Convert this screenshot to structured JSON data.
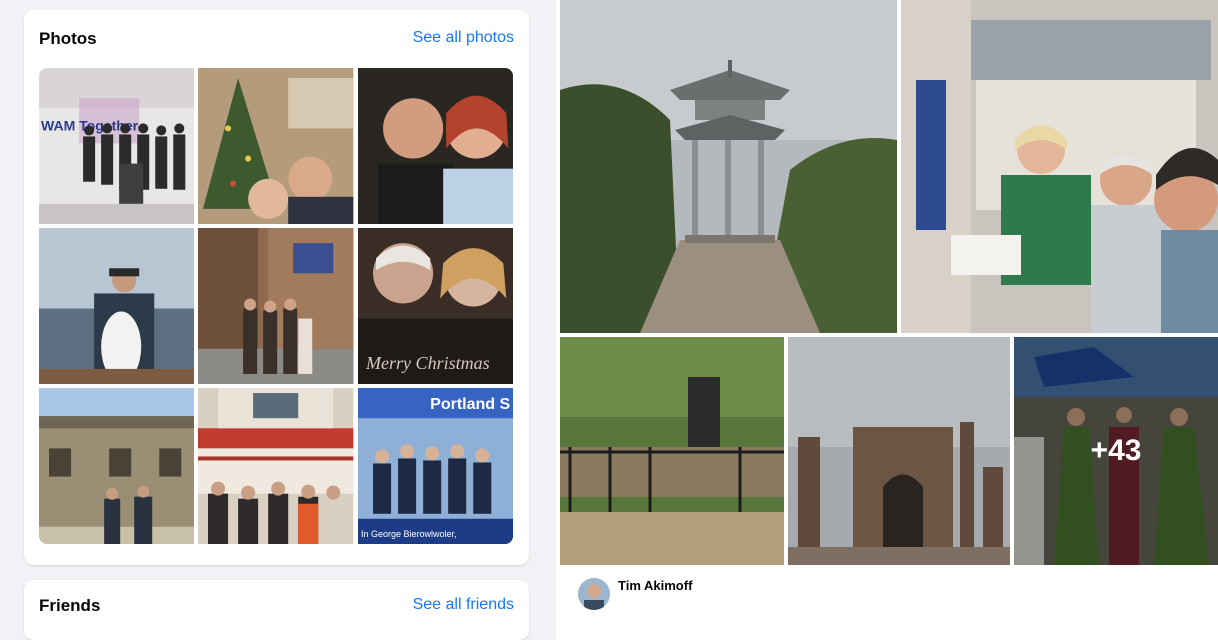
{
  "photos": {
    "title": "Photos",
    "see_all": "See all photos",
    "thumbnails": [
      {
        "name": "group-event-photo",
        "text": "WAM Together"
      },
      {
        "name": "christmas-tree-photo"
      },
      {
        "name": "couple-selfie-photo"
      },
      {
        "name": "fishing-photo"
      },
      {
        "name": "street-group-photo"
      },
      {
        "name": "merry-christmas-photo",
        "text": "Merry Christmas"
      },
      {
        "name": "house-photo"
      },
      {
        "name": "boat-group-photo"
      },
      {
        "name": "portland-group-photo",
        "text": "Portland S",
        "caption": "In George Bierowlwoler,"
      }
    ]
  },
  "friends": {
    "title": "Friends",
    "see_all": "See all friends"
  },
  "post": {
    "more_count": "+43",
    "author": "Tim Akimoff"
  },
  "colors": {
    "link": "#1877f2",
    "card_bg": "#ffffff",
    "page_bg": "#f0f2f5"
  }
}
